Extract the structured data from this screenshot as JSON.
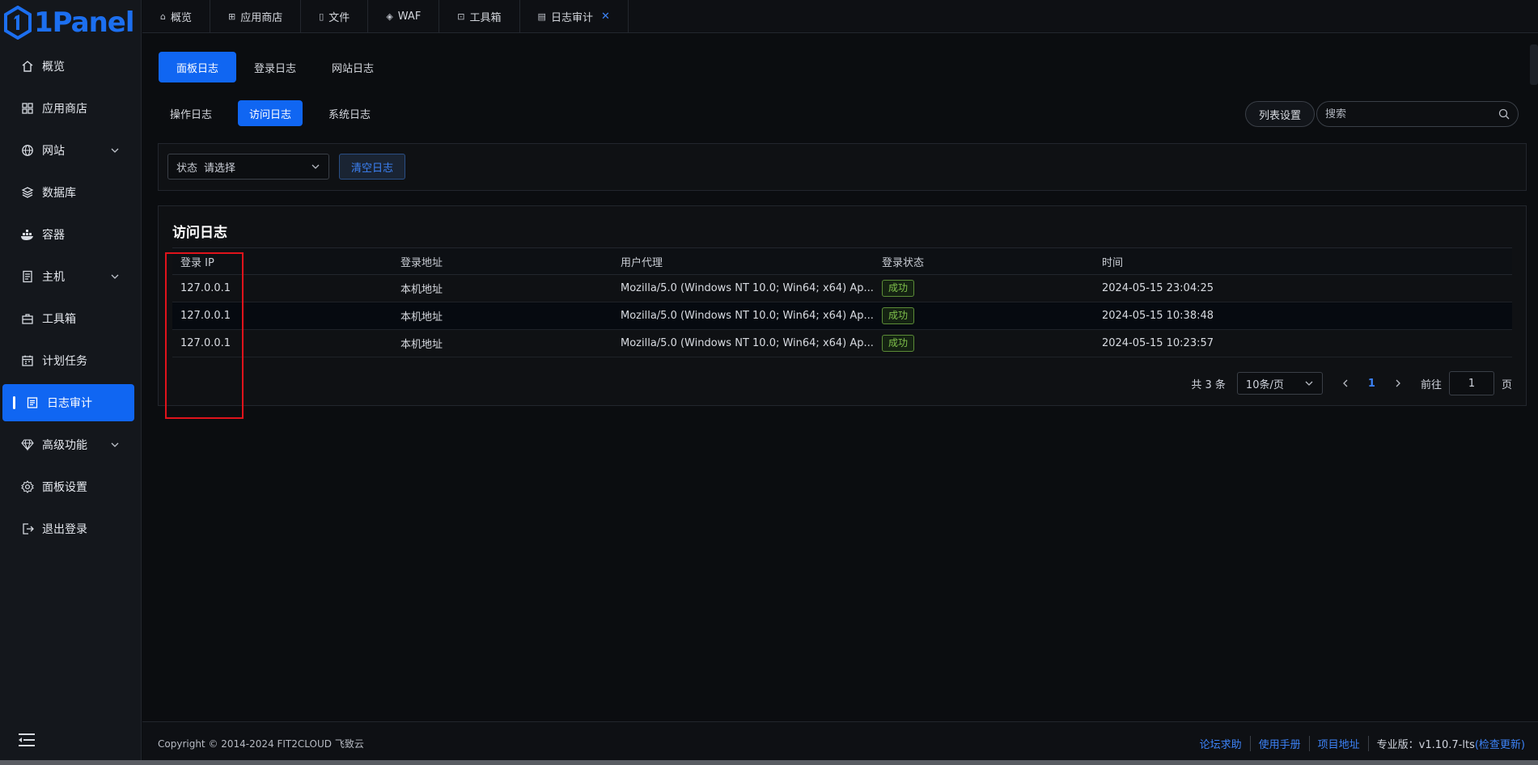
{
  "brand": {
    "name": "1Panel"
  },
  "sidebar": {
    "items": [
      {
        "label": "概览",
        "icon": "home-icon"
      },
      {
        "label": "应用商店",
        "icon": "apps-icon"
      },
      {
        "label": "网站",
        "icon": "globe-icon",
        "expandable": true
      },
      {
        "label": "数据库",
        "icon": "database-icon"
      },
      {
        "label": "容器",
        "icon": "docker-icon"
      },
      {
        "label": "主机",
        "icon": "server-icon",
        "expandable": true
      },
      {
        "label": "工具箱",
        "icon": "toolbox-icon"
      },
      {
        "label": "计划任务",
        "icon": "calendar-icon"
      },
      {
        "label": "日志审计",
        "icon": "log-icon",
        "active": true
      },
      {
        "label": "高级功能",
        "icon": "diamond-icon",
        "expandable": true
      },
      {
        "label": "面板设置",
        "icon": "gear-icon"
      },
      {
        "label": "退出登录",
        "icon": "logout-icon"
      }
    ]
  },
  "tabs": [
    {
      "label": "概览",
      "icon": "⌂"
    },
    {
      "label": "应用商店",
      "icon": "⊞"
    },
    {
      "label": "文件",
      "icon": "▯"
    },
    {
      "label": "WAF",
      "icon": "◈"
    },
    {
      "label": "工具箱",
      "icon": "⊡"
    },
    {
      "label": "日志审计",
      "icon": "▤",
      "active": true,
      "close": "✕"
    }
  ],
  "log_types": [
    "面板日志",
    "登录日志",
    "网站日志"
  ],
  "sub_tabs": [
    "操作日志",
    "访问日志",
    "系统日志"
  ],
  "toolbar": {
    "column_settings": "列表设置",
    "search_placeholder": "搜索"
  },
  "filter": {
    "status_label": "状态",
    "status_placeholder": "请选择",
    "clear_button": "清空日志"
  },
  "table": {
    "title": "访问日志",
    "columns": [
      "登录 IP",
      "登录地址",
      "用户代理",
      "登录状态",
      "时间"
    ],
    "rows": [
      {
        "ip": "127.0.0.1",
        "address": "本机地址",
        "agent": "Mozilla/5.0 (Windows NT 10.0; Win64; x64) Ap...",
        "status": "成功",
        "time": "2024-05-15 23:04:25"
      },
      {
        "ip": "127.0.0.1",
        "address": "本机地址",
        "agent": "Mozilla/5.0 (Windows NT 10.0; Win64; x64) Ap...",
        "status": "成功",
        "time": "2024-05-15 10:38:48"
      },
      {
        "ip": "127.0.0.1",
        "address": "本机地址",
        "agent": "Mozilla/5.0 (Windows NT 10.0; Win64; x64) Ap...",
        "status": "成功",
        "time": "2024-05-15 10:23:57"
      }
    ]
  },
  "pagination": {
    "total": "共 3 条",
    "page_size": "10条/页",
    "current_page": "1",
    "goto_label": "前往",
    "goto_value": "1",
    "page_unit": "页"
  },
  "footer": {
    "copyright": "Copyright © 2014-2024 FIT2CLOUD 飞致云",
    "links": [
      "论坛求助",
      "使用手册",
      "项目地址"
    ],
    "edition_label": "专业版：",
    "version": "v1.10.7-lts",
    "check_update": "(检查更新)"
  },
  "colors": {
    "accent": "#1066f2",
    "success": "#7fc04b",
    "highlight": "#e0131b"
  }
}
